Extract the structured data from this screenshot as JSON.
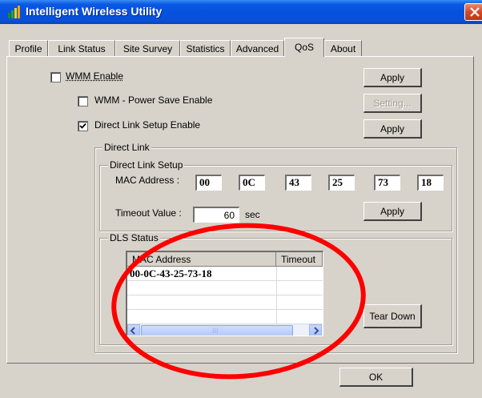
{
  "window": {
    "title": "Intelligent Wireless Utility"
  },
  "tabs": [
    {
      "label": "Profile",
      "active": false
    },
    {
      "label": "Link Status",
      "active": false
    },
    {
      "label": "Site Survey",
      "active": false
    },
    {
      "label": "Statistics",
      "active": false
    },
    {
      "label": "Advanced",
      "active": false
    },
    {
      "label": "QoS",
      "active": true
    },
    {
      "label": "About",
      "active": false
    }
  ],
  "qos": {
    "wmm_enable": {
      "label": "WMM Enable",
      "checked": false
    },
    "wmm_power_save": {
      "label": "WMM - Power Save Enable",
      "checked": false
    },
    "direct_link_setup": {
      "label": "Direct Link Setup Enable",
      "checked": true
    },
    "apply_label": "Apply",
    "setting_label": "Setting..."
  },
  "direct_link": {
    "group_title": "Direct Link",
    "setup_title": "Direct Link Setup",
    "mac_label": "MAC Address :",
    "mac_octets": [
      "00",
      "0C",
      "43",
      "25",
      "73",
      "18"
    ],
    "timeout_label": "Timeout Value :",
    "timeout_value": "60",
    "timeout_unit": "sec",
    "apply_label": "Apply"
  },
  "dls_status": {
    "group_title": "DLS Status",
    "columns": [
      "MAC Address",
      "Timeout"
    ],
    "rows": [
      {
        "mac": "00-0C-43-25-73-18",
        "timeout": ""
      }
    ],
    "scroll_thumb_label": "III",
    "teardown_label": "Tear Down"
  },
  "footer": {
    "ok_label": "OK"
  },
  "colors": {
    "titlebar": "#0550de",
    "face": "#d7d3ca",
    "annotation": "#ff0000",
    "close": "#d24a27"
  },
  "icons": [
    "app-signal-icon",
    "close-icon",
    "check-icon",
    "scroll-left-icon",
    "scroll-right-icon"
  ]
}
